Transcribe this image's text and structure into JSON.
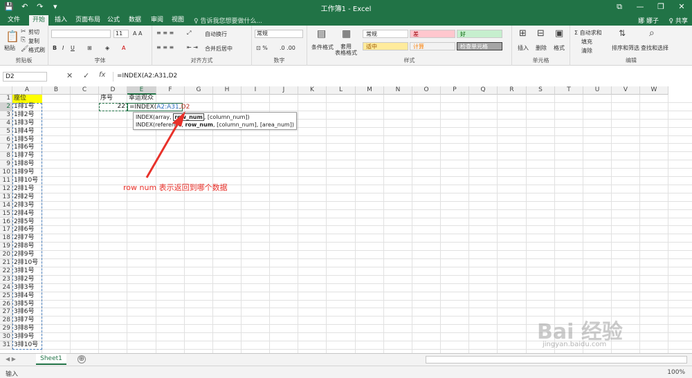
{
  "window": {
    "title": "工作簿1 - Excel",
    "qat": [
      "💾",
      "↶",
      "↷",
      "▾"
    ],
    "controls": [
      "⧉",
      "—",
      "❐",
      "✕"
    ]
  },
  "tabs": [
    "文件",
    "开始",
    "插入",
    "页面布局",
    "公式",
    "数据",
    "审阅",
    "视图"
  ],
  "active_tab": "开始",
  "tellme": "♀ 告诉我您想要做什么...",
  "user": "娜 娜子",
  "share": "♀ 共享",
  "ribbon": {
    "clipboard": {
      "label": "剪贴板",
      "paste": "粘贴",
      "cut": "剪切",
      "copy": "复制",
      "format_painter": "格式刷"
    },
    "font": {
      "label": "字体",
      "size": "11"
    },
    "alignment": {
      "label": "对齐方式",
      "wrap": "自动换行",
      "merge": "合并后居中"
    },
    "number": {
      "label": "数字",
      "format": "常规"
    },
    "styles": {
      "label": "样式",
      "cond_format": "条件格式",
      "table_format": "套用\n表格格式",
      "cells": [
        "常规",
        "差",
        "好",
        "适中",
        "计算",
        "检查单元格"
      ]
    },
    "cells": {
      "label": "单元格",
      "insert": "插入",
      "delete": "删除",
      "format": "格式"
    },
    "editing": {
      "label": "编辑",
      "autosum": "Σ 自动求和",
      "fill": "填充",
      "clear": "清除",
      "sort": "排序和筛选",
      "find": "查找和选择"
    }
  },
  "formula_bar": {
    "name_box": "D2",
    "cancel": "✕",
    "enter": "✓",
    "fx": "fx",
    "formula": "=INDEX(A2:A31,D2"
  },
  "columns": [
    "A",
    "B",
    "C",
    "D",
    "E",
    "F",
    "G",
    "H",
    "I",
    "J",
    "K",
    "L",
    "M",
    "N",
    "O",
    "P",
    "Q",
    "R",
    "S",
    "T",
    "U",
    "V",
    "W"
  ],
  "rows": [
    "1",
    "2",
    "3",
    "4",
    "5",
    "6",
    "7",
    "8",
    "9",
    "10",
    "11",
    "12",
    "13",
    "14",
    "15",
    "16",
    "17",
    "18",
    "19",
    "20",
    "21",
    "22",
    "23",
    "24",
    "25",
    "26",
    "27",
    "28",
    "29",
    "30",
    "31"
  ],
  "column_a": [
    "座位",
    "1排1号",
    "1排2号",
    "1排3号",
    "1排4号",
    "1排5号",
    "1排6号",
    "1排7号",
    "1排8号",
    "1排9号",
    "1排10号",
    "2排1号",
    "2排2号",
    "2排3号",
    "2排4号",
    "2排5号",
    "2排6号",
    "2排7号",
    "2排8号",
    "2排9号",
    "2排10号",
    "3排1号",
    "3排2号",
    "3排3号",
    "3排4号",
    "3排5号",
    "3排6号",
    "3排7号",
    "3排8号",
    "3排9号",
    "3排10号"
  ],
  "d1": "序号",
  "e1": "幸运观众",
  "d2": "22",
  "e2_prefix": "=INDEX(",
  "e2_range": "A2:A31",
  "e2_comma": ",",
  "e2_ref": "D2",
  "tooltip": {
    "line1_prefix": "INDEX(array, ",
    "line1_param": "row_num",
    "line1_suffix": ", [column_num])",
    "line2_prefix": "INDEX(reference, ",
    "line2_param": "row_num",
    "line2_suffix": ", [column_num], [area_num])"
  },
  "annotation": "row num 表示返回到哪个数据",
  "sheet_tab": "Sheet1",
  "add_sheet": "⊕",
  "status": "输入",
  "zoom": "100%",
  "watermark": "Bai 经验",
  "watermark_url": "jingyan.baidu.com",
  "colors": {
    "brand": "#217346",
    "annot": "#e8312a",
    "highlight": "#ffff00"
  }
}
